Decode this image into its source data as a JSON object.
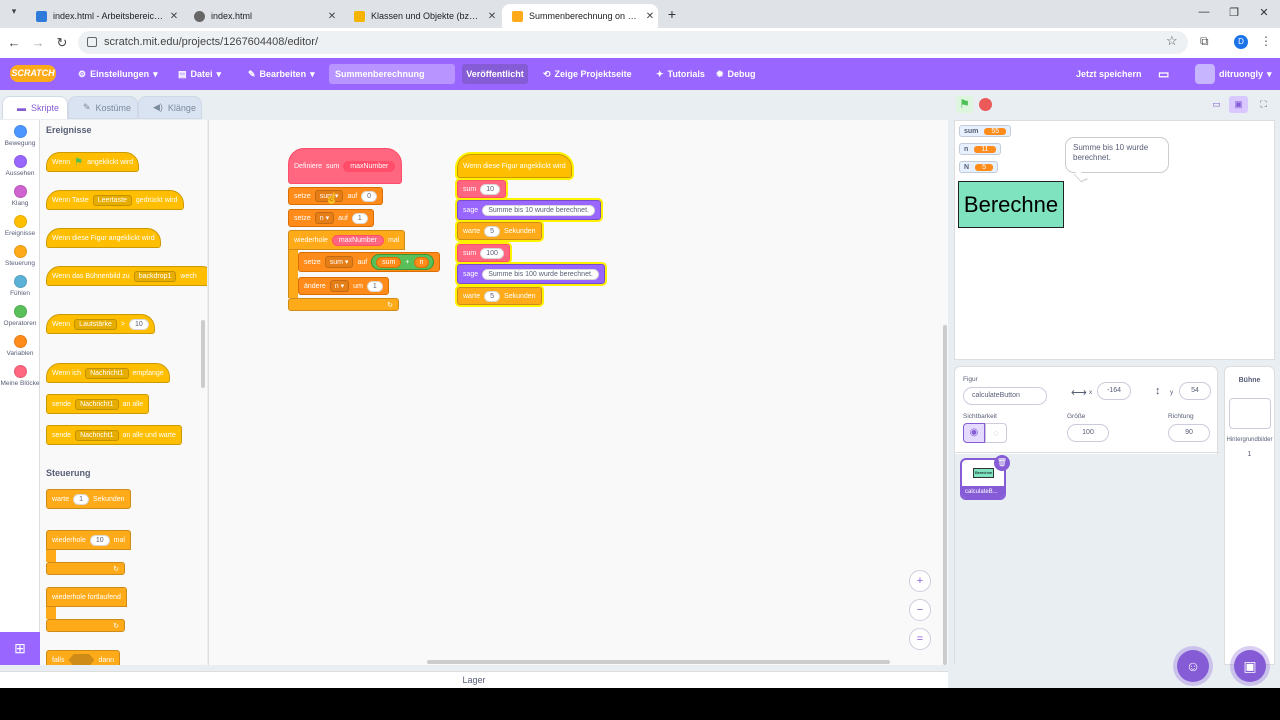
{
  "browser": {
    "tabs": [
      {
        "title": "index.html - Arbeitsbereich - V",
        "active": false,
        "favicon_color": "#2f7bd9"
      },
      {
        "title": "index.html",
        "active": false,
        "favicon_color": "#666666"
      },
      {
        "title": "Klassen und Objekte (bzw. Insta",
        "active": false,
        "favicon_color": "#f4b400"
      },
      {
        "title": "Summenberechnung on Scratch",
        "active": true,
        "favicon_color": "#ffab19"
      }
    ],
    "url": "scratch.mit.edu/projects/1267604408/editor/",
    "profile_initial": "D"
  },
  "menu": {
    "logo": "SCRATCH",
    "settings": "Einstellungen",
    "file": "Datei",
    "edit": "Bearbeiten",
    "project_title": "Summenberechnung",
    "share": "Veröffentlicht",
    "see_project": "Zeige Projektseite",
    "tutorials": "Tutorials",
    "debug": "Debug",
    "save_now": "Jetzt speichern",
    "username": "ditruongly"
  },
  "editor_tabs": {
    "code": "Skripte",
    "costumes": "Kostüme",
    "sounds": "Klänge"
  },
  "categories": [
    {
      "label": "Bewegung",
      "color": "#4c97ff"
    },
    {
      "label": "Aussehen",
      "color": "#9966ff"
    },
    {
      "label": "Klang",
      "color": "#cf63cf"
    },
    {
      "label": "Ereignisse",
      "color": "#ffbf00"
    },
    {
      "label": "Steuerung",
      "color": "#ffab19"
    },
    {
      "label": "Fühlen",
      "color": "#5cb1d6"
    },
    {
      "label": "Operatoren",
      "color": "#59c059"
    },
    {
      "label": "Variablen",
      "color": "#ff8c1a"
    },
    {
      "label": "Meine Blöcke",
      "color": "#ff6680"
    }
  ],
  "palette": {
    "events_header": "Ereignisse",
    "control_header": "Steuerung",
    "when_flag_a": "Wenn",
    "when_flag_b": "angeklickt wird",
    "when_key_a": "Wenn Taste",
    "when_key_b": "Leertaste",
    "when_key_c": "gedrückt wird",
    "when_sprite": "Wenn diese Figur angeklickt wird",
    "when_backdrop_a": "Wenn das Bühnenbild zu",
    "when_backdrop_b": "backdrop1",
    "when_backdrop_c": "wech",
    "when_loud_a": "Wenn",
    "when_loud_b": "Lautstärke",
    "when_loud_c": ">",
    "when_loud_d": "10",
    "when_receive_a": "Wenn ich",
    "when_receive_b": "Nachricht1",
    "when_receive_c": "empfange",
    "broadcast_a": "sende",
    "broadcast_b": "Nachricht1",
    "broadcast_c": "an alle",
    "broadcast_wait_a": "sende",
    "broadcast_wait_b": "Nachricht1",
    "broadcast_wait_c": "an alle und warte",
    "wait_a": "warte",
    "wait_b": "1",
    "wait_c": "Sekunden",
    "repeat_a": "wiederhole",
    "repeat_b": "10",
    "repeat_c": "mal",
    "forever": "wiederhole fortlaufend",
    "if_a": "falls",
    "if_b": "dann"
  },
  "script1": {
    "define": "Definiere",
    "define_name": "sum",
    "define_param": "maxNumber",
    "set1_a": "setze",
    "set1_var": "sum",
    "set1_b": "auf",
    "set1_val": "0",
    "set2_a": "setze",
    "set2_var": "n",
    "set2_b": "auf",
    "set2_val": "1",
    "repeat_a": "wiederhole",
    "repeat_param": "maxNumber",
    "repeat_b": "mal",
    "set3_a": "setze",
    "set3_var": "sum",
    "set3_b": "auf",
    "set3_op_l": "sum",
    "set3_op": "+",
    "set3_op_r": "n",
    "change_a": "ändere",
    "change_var": "n",
    "change_b": "um",
    "change_val": "1"
  },
  "script2": {
    "hat": "Wenn diese Figur angeklickt wird",
    "call1": "sum",
    "call1_val": "10",
    "say1": "sage",
    "say1_val": "Summe bis 10 wurde berechnet.",
    "wait1_a": "warte",
    "wait1_val": "5",
    "wait1_b": "Sekunden",
    "call2": "sum",
    "call2_val": "100",
    "say2": "sage",
    "say2_val": "Summe bis 100 wurde berechnet.",
    "wait2_a": "warte",
    "wait2_val": "5",
    "wait2_b": "Sekunden"
  },
  "backpack": "Lager",
  "stage": {
    "monitors": [
      {
        "name": "sum",
        "value": "55"
      },
      {
        "name": "n",
        "value": "11"
      },
      {
        "name": "N",
        "value": "5"
      }
    ],
    "bubble": "Summe bis 10 wurde berechnet.",
    "sprite_text": "Berechne"
  },
  "sprite_info": {
    "sprite_label": "Figur",
    "sprite_name": "calculateButton",
    "x_label": "x",
    "x": "-164",
    "y_label": "y",
    "y": "54",
    "show_label": "Sichtbarkeit",
    "size_label": "Größe",
    "size": "100",
    "direction_label": "Richtung",
    "direction": "90",
    "thumb_name": "calculateB...",
    "thumb_text": "Berechne"
  },
  "stage_pane": {
    "title": "Bühne",
    "backdrops_label": "Hintergrundbilder",
    "backdrops_count": "1"
  }
}
